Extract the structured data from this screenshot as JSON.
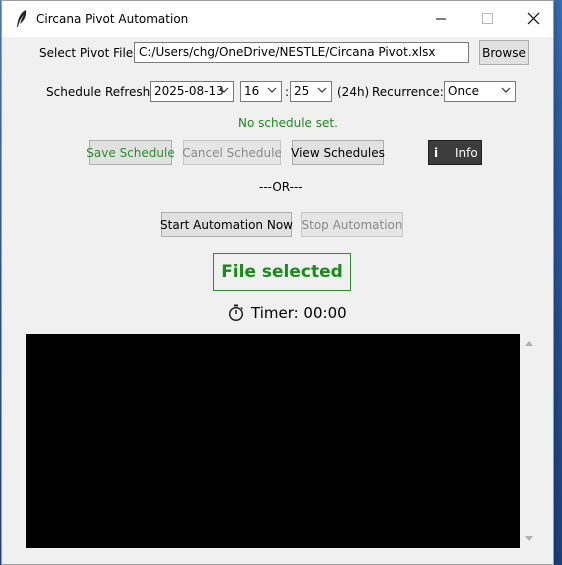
{
  "window": {
    "title": "Circana Pivot Automation",
    "icon": "feather-icon",
    "controls": [
      "minimize-icon",
      "maximize-icon",
      "close-icon"
    ]
  },
  "file_row": {
    "label": "Select Pivot File:",
    "path_value": "C:/Users/chg/OneDrive/NESTLE/Circana Pivot.xlsx",
    "browse_label": "Browse"
  },
  "schedule_row": {
    "label": "Schedule Refresh:",
    "date_value": "2025-08-13",
    "hour_value": "16",
    "time_sep": ":",
    "minute_value": "25",
    "format_hint": "(24h)",
    "recurrence_label": "Recurrence:",
    "recurrence_value": "Once"
  },
  "status": {
    "text": "No schedule set.",
    "color": "#1a8a1a"
  },
  "schedule_buttons": {
    "save": "Save Schedule",
    "cancel": "Cancel Schedule",
    "view": "View Schedules",
    "info_icon": "i",
    "info": "Info"
  },
  "or_separator": "---OR---",
  "automation_buttons": {
    "start": "Start Automation Now",
    "stop": "Stop Automation"
  },
  "file_status": "File selected",
  "timer": {
    "icon": "stopwatch-icon",
    "text": "Timer: 00:00"
  },
  "console": {
    "background": "#000000"
  }
}
